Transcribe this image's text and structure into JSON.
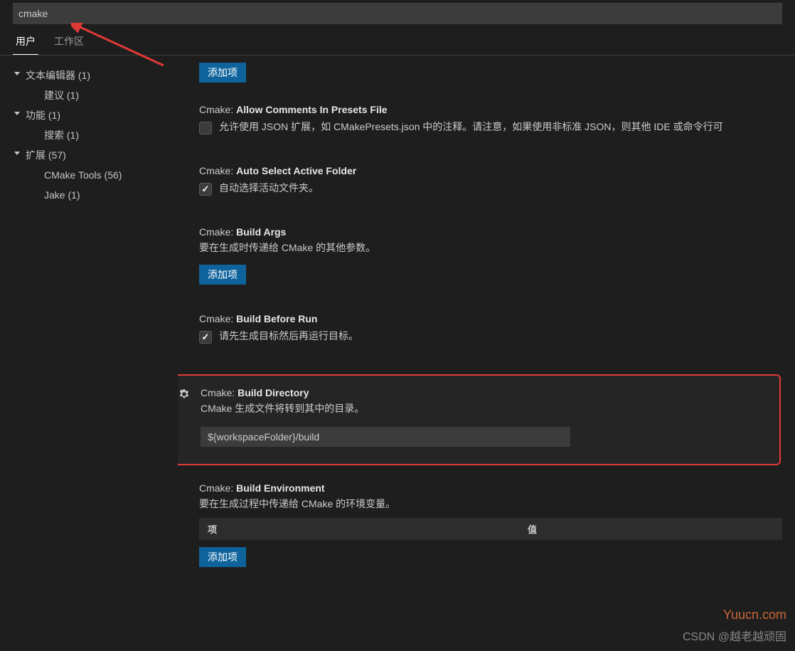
{
  "search": {
    "value": "cmake"
  },
  "tabs": {
    "user": "用户",
    "workspace": "工作区"
  },
  "sidebar": {
    "items": [
      {
        "label": "文本编辑器 (1)",
        "kind": "parent"
      },
      {
        "label": "建议 (1)",
        "kind": "child"
      },
      {
        "label": "功能 (1)",
        "kind": "parent"
      },
      {
        "label": "搜索 (1)",
        "kind": "child"
      },
      {
        "label": "扩展 (57)",
        "kind": "parent"
      },
      {
        "label": "CMake Tools (56)",
        "kind": "child"
      },
      {
        "label": "Jake (1)",
        "kind": "child"
      }
    ]
  },
  "settings": {
    "top_btn": "添加项",
    "s1": {
      "prefix": "Cmake: ",
      "title": "Allow Comments In Presets File",
      "desc": "允许使用 JSON 扩展，如 CMakePresets.json 中的注释。请注意，如果使用非标准 JSON，则其他 IDE 或命令行可"
    },
    "s2": {
      "prefix": "Cmake: ",
      "title": "Auto Select Active Folder",
      "desc": "自动选择活动文件夹。"
    },
    "s3": {
      "prefix": "Cmake: ",
      "title": "Build Args",
      "desc": "要在生成时传递给 CMake 的其他参数。",
      "btn": "添加项"
    },
    "s4": {
      "prefix": "Cmake: ",
      "title": "Build Before Run",
      "desc": "请先生成目标然后再运行目标。"
    },
    "s5": {
      "prefix": "Cmake: ",
      "title": "Build Directory",
      "desc": "CMake 生成文件将转到其中的目录。",
      "value": "${workspaceFolder}/build"
    },
    "s6": {
      "prefix": "Cmake: ",
      "title": "Build Environment",
      "desc": "要在生成过程中传递给 CMake 的环境变量。",
      "col1": "项",
      "col2": "值",
      "btn": "添加项"
    }
  },
  "watermark": "Yuucn.com",
  "csdn": "CSDN @越老越顽固"
}
